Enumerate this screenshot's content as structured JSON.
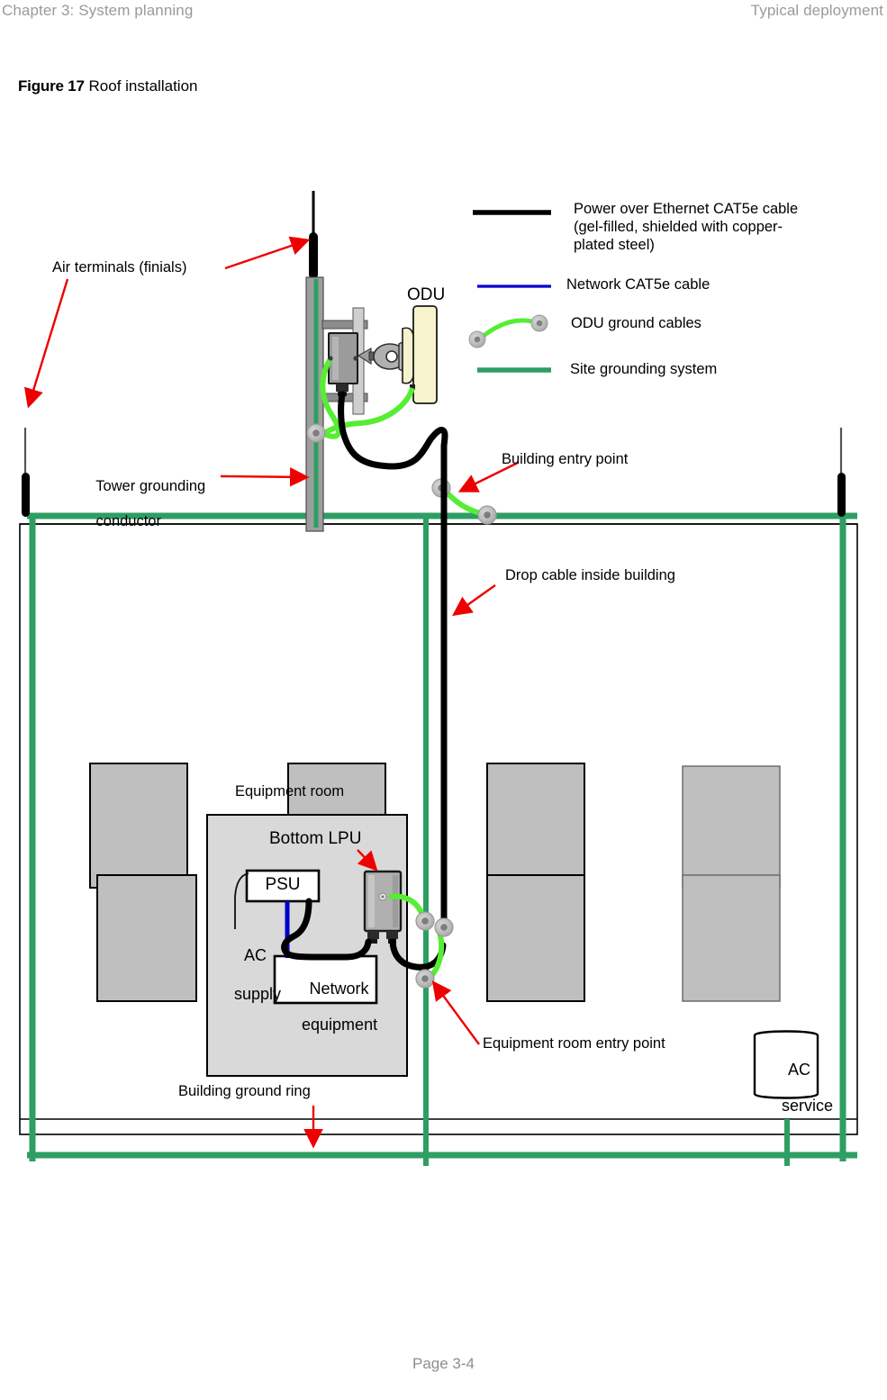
{
  "header": {
    "left": "Chapter 3:  System planning",
    "right": "Typical deployment"
  },
  "figure": {
    "number": "Figure 17",
    "title": "Roof installation"
  },
  "footer": {
    "page": "Page 3-4"
  },
  "legend": {
    "items": [
      {
        "key": "poe-cable",
        "label": "Power over Ethernet CAT5e cable (gel-filled, shielded with copper-plated steel)",
        "line1": "Power over Ethernet CAT5e cable",
        "line2": "(gel-filled, shielded with copper-",
        "line3": "plated steel)",
        "color": "#000000",
        "style": "solid-thick"
      },
      {
        "key": "network-cable",
        "label": "Network CAT5e cable",
        "line1": "Network CAT5e cable",
        "color": "#0000cc",
        "style": "solid"
      },
      {
        "key": "odu-ground-cables",
        "label": "ODU ground cables",
        "line1": "ODU ground cables",
        "color": "#55ee33",
        "style": "curve-with-lugs"
      },
      {
        "key": "site-grounding-system",
        "label": "Site grounding system",
        "line1": "Site grounding system",
        "color": "#2e9e63",
        "style": "solid-thick"
      }
    ]
  },
  "diagram": {
    "callouts": [
      {
        "key": "air-terminals",
        "text": "Air terminals (finials)"
      },
      {
        "key": "tower-grounding-conductor",
        "line1": "Tower grounding",
        "line2": "conductor"
      },
      {
        "key": "odu",
        "text": "ODU"
      },
      {
        "key": "building-entry-point",
        "text": "Building entry point"
      },
      {
        "key": "drop-cable-inside-building",
        "text": "Drop cable inside building"
      },
      {
        "key": "equipment-room",
        "text": "Equipment room"
      },
      {
        "key": "bottom-lpu",
        "text": "Bottom LPU"
      },
      {
        "key": "psu",
        "text": "PSU"
      },
      {
        "key": "ac-supply",
        "line1": "AC",
        "line2": "supply"
      },
      {
        "key": "network-equipment",
        "line1": "Network",
        "line2": "equipment"
      },
      {
        "key": "equipment-room-entry-point",
        "text": "Equipment room entry point"
      },
      {
        "key": "building-ground-ring",
        "text": "Building ground ring"
      },
      {
        "key": "ac-service",
        "line1": "AC",
        "line2": "service"
      }
    ],
    "colors": {
      "ground_ring": "#2e9e63",
      "odu_ground_cable": "#55ee33",
      "poe_cable": "#000000",
      "network_cable": "#0000cc",
      "arrow": "#ee0000",
      "room_fill": "#bfbfbf",
      "equipment_room_fill": "#d9d9d9",
      "odu_fill": "#f5f0c0",
      "lug": "#b3b3b3"
    }
  }
}
